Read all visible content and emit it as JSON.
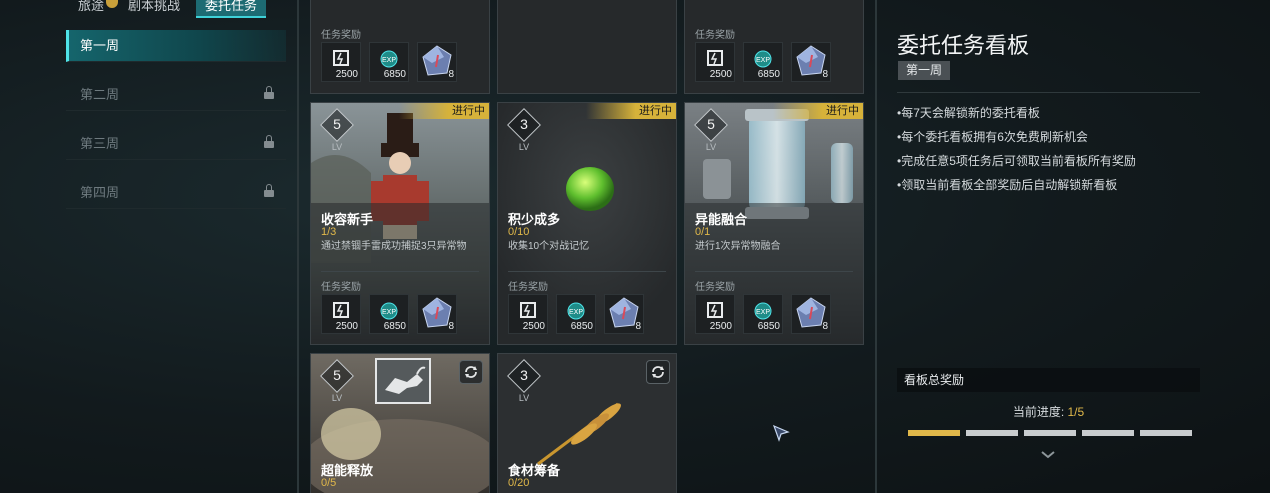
{
  "top_tabs": [
    {
      "label": "旅途"
    },
    {
      "label": "剧本挑战"
    },
    {
      "label": "委托任务"
    }
  ],
  "sidebar": {
    "weeks": [
      {
        "label": "第一周",
        "locked": false,
        "active": true
      },
      {
        "label": "第二周",
        "locked": true
      },
      {
        "label": "第三周",
        "locked": true
      },
      {
        "label": "第四周",
        "locked": true
      }
    ]
  },
  "reward_label": "任务奖励",
  "rewards": [
    {
      "icon": "stamina-icon",
      "value": "2500"
    },
    {
      "icon": "exp-icon",
      "value": "6850"
    },
    {
      "icon": "crystal-icon",
      "value": "8"
    }
  ],
  "status_in_progress": "进行中",
  "lv_label": "LV",
  "tasks": [
    {
      "level": "5",
      "title": "收容新手",
      "progress": "1/3",
      "desc": "通过禁锢手雷成功捕捉3只异常物",
      "status": "进行中"
    },
    {
      "level": "3",
      "title": "积少成多",
      "progress": "0/10",
      "desc": "收集10个对战记忆",
      "status": "进行中"
    },
    {
      "level": "5",
      "title": "异能融合",
      "progress": "0/1",
      "desc": "进行1次异常物融合",
      "status": "进行中"
    },
    {
      "level": "5",
      "title": "超能释放",
      "progress": "0/5"
    },
    {
      "level": "3",
      "title": "食材筹备",
      "progress": "0/20"
    }
  ],
  "panel": {
    "title": "委托任务看板",
    "badge": "第一周",
    "rules": [
      "•每7天会解锁新的委托看板",
      "•每个委托看板拥有6次免费刷新机会",
      "•完成任意5项任务后可领取当前看板所有奖励",
      "•领取当前看板全部奖励后自动解锁新看板"
    ],
    "total_reward_label": "看板总奖励",
    "current_progress_label": "当前进度: ",
    "current_progress_value": "1/5",
    "progress_segments": 5,
    "progress_filled": 1
  },
  "colors": {
    "accent_teal": "#1d6b73",
    "status_gold": "#d6b23a",
    "progress_gold": "#e0b84a"
  }
}
